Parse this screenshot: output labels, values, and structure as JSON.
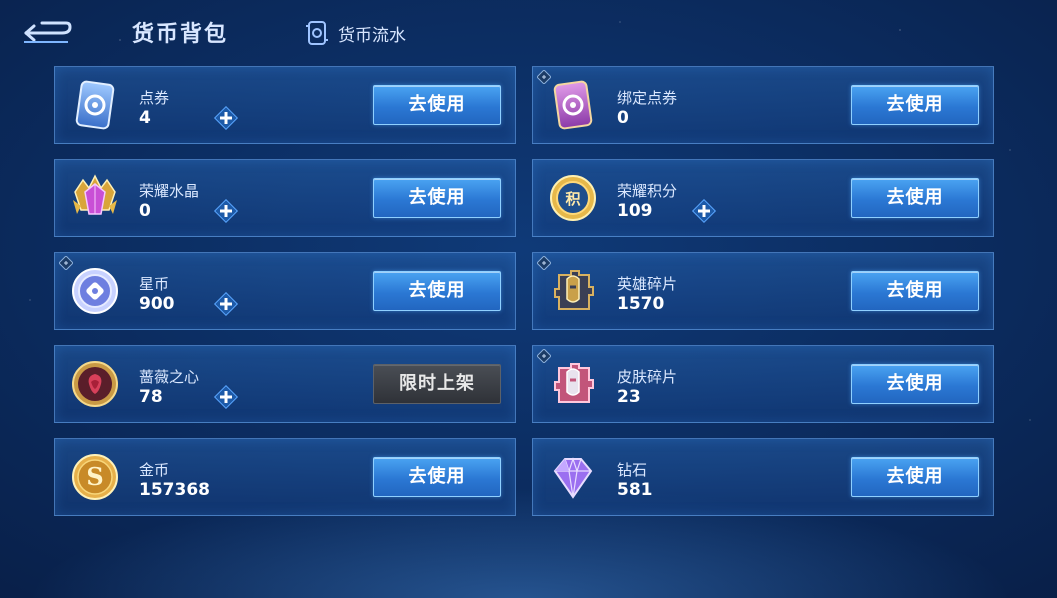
{
  "header": {
    "title": "货币背包",
    "flow_label": "货币流水"
  },
  "colors": {
    "accent_blue": "#2b78d4",
    "card_border": "#6eaaf0",
    "background": "#0b2a5c"
  },
  "items": [
    {
      "name": "点券",
      "amount": "4",
      "has_plus": true,
      "button": "去使用",
      "locked": false,
      "icon": "blue-ticket-icon"
    },
    {
      "name": "绑定点券",
      "amount": "0",
      "has_plus": false,
      "button": "去使用",
      "locked": true,
      "icon": "purple-ticket-icon"
    },
    {
      "name": "荣耀水晶",
      "amount": "0",
      "has_plus": true,
      "button": "去使用",
      "locked": false,
      "icon": "glory-crystal-icon"
    },
    {
      "name": "荣耀积分",
      "amount": "109",
      "has_plus": true,
      "button": "去使用",
      "locked": false,
      "icon": "glory-points-icon"
    },
    {
      "name": "星币",
      "amount": "900",
      "has_plus": true,
      "button": "去使用",
      "locked": true,
      "icon": "star-coin-icon"
    },
    {
      "name": "英雄碎片",
      "amount": "1570",
      "has_plus": false,
      "button": "去使用",
      "locked": true,
      "icon": "hero-fragment-icon"
    },
    {
      "name": "蔷薇之心",
      "amount": "78",
      "has_plus": true,
      "button": "限时上架",
      "locked": false,
      "icon": "rose-heart-icon"
    },
    {
      "name": "皮肤碎片",
      "amount": "23",
      "has_plus": false,
      "button": "去使用",
      "locked": true,
      "icon": "skin-fragment-icon"
    },
    {
      "name": "金币",
      "amount": "157368",
      "has_plus": false,
      "button": "去使用",
      "locked": false,
      "icon": "gold-coin-icon"
    },
    {
      "name": "钻石",
      "amount": "581",
      "has_plus": false,
      "button": "去使用",
      "locked": false,
      "icon": "diamond-icon"
    }
  ]
}
